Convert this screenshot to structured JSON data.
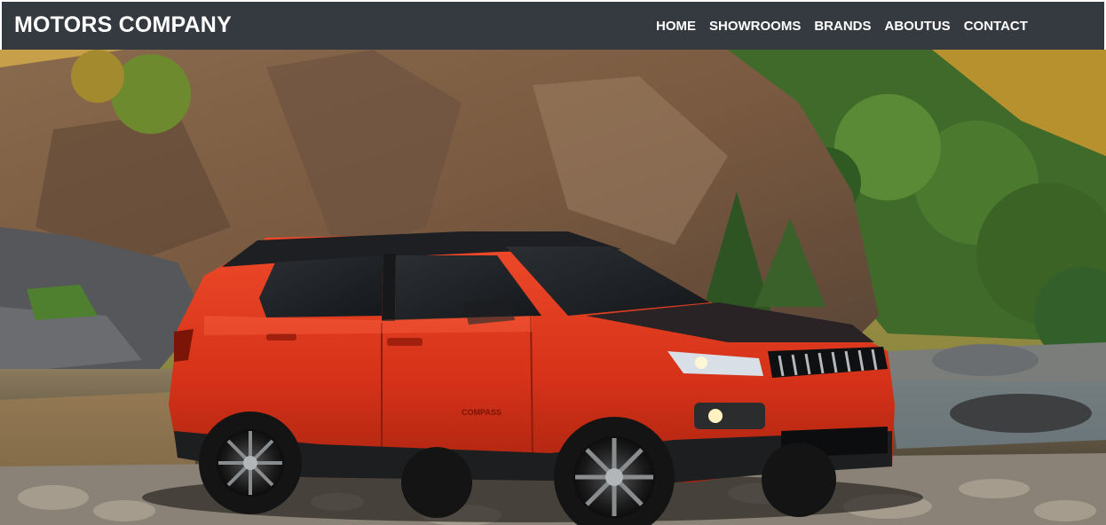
{
  "navbar": {
    "brand": "MOTORS COMPANY",
    "links": [
      {
        "label": "HOME"
      },
      {
        "label": "SHOWROOMS"
      },
      {
        "label": "BRANDS"
      },
      {
        "label": "ABOUTUS"
      },
      {
        "label": "CONTACT"
      }
    ]
  },
  "hero": {
    "image_subject": "red-suv-by-river",
    "vehicle_color": "#d8321c",
    "vehicle_badge": "COMPASS"
  }
}
